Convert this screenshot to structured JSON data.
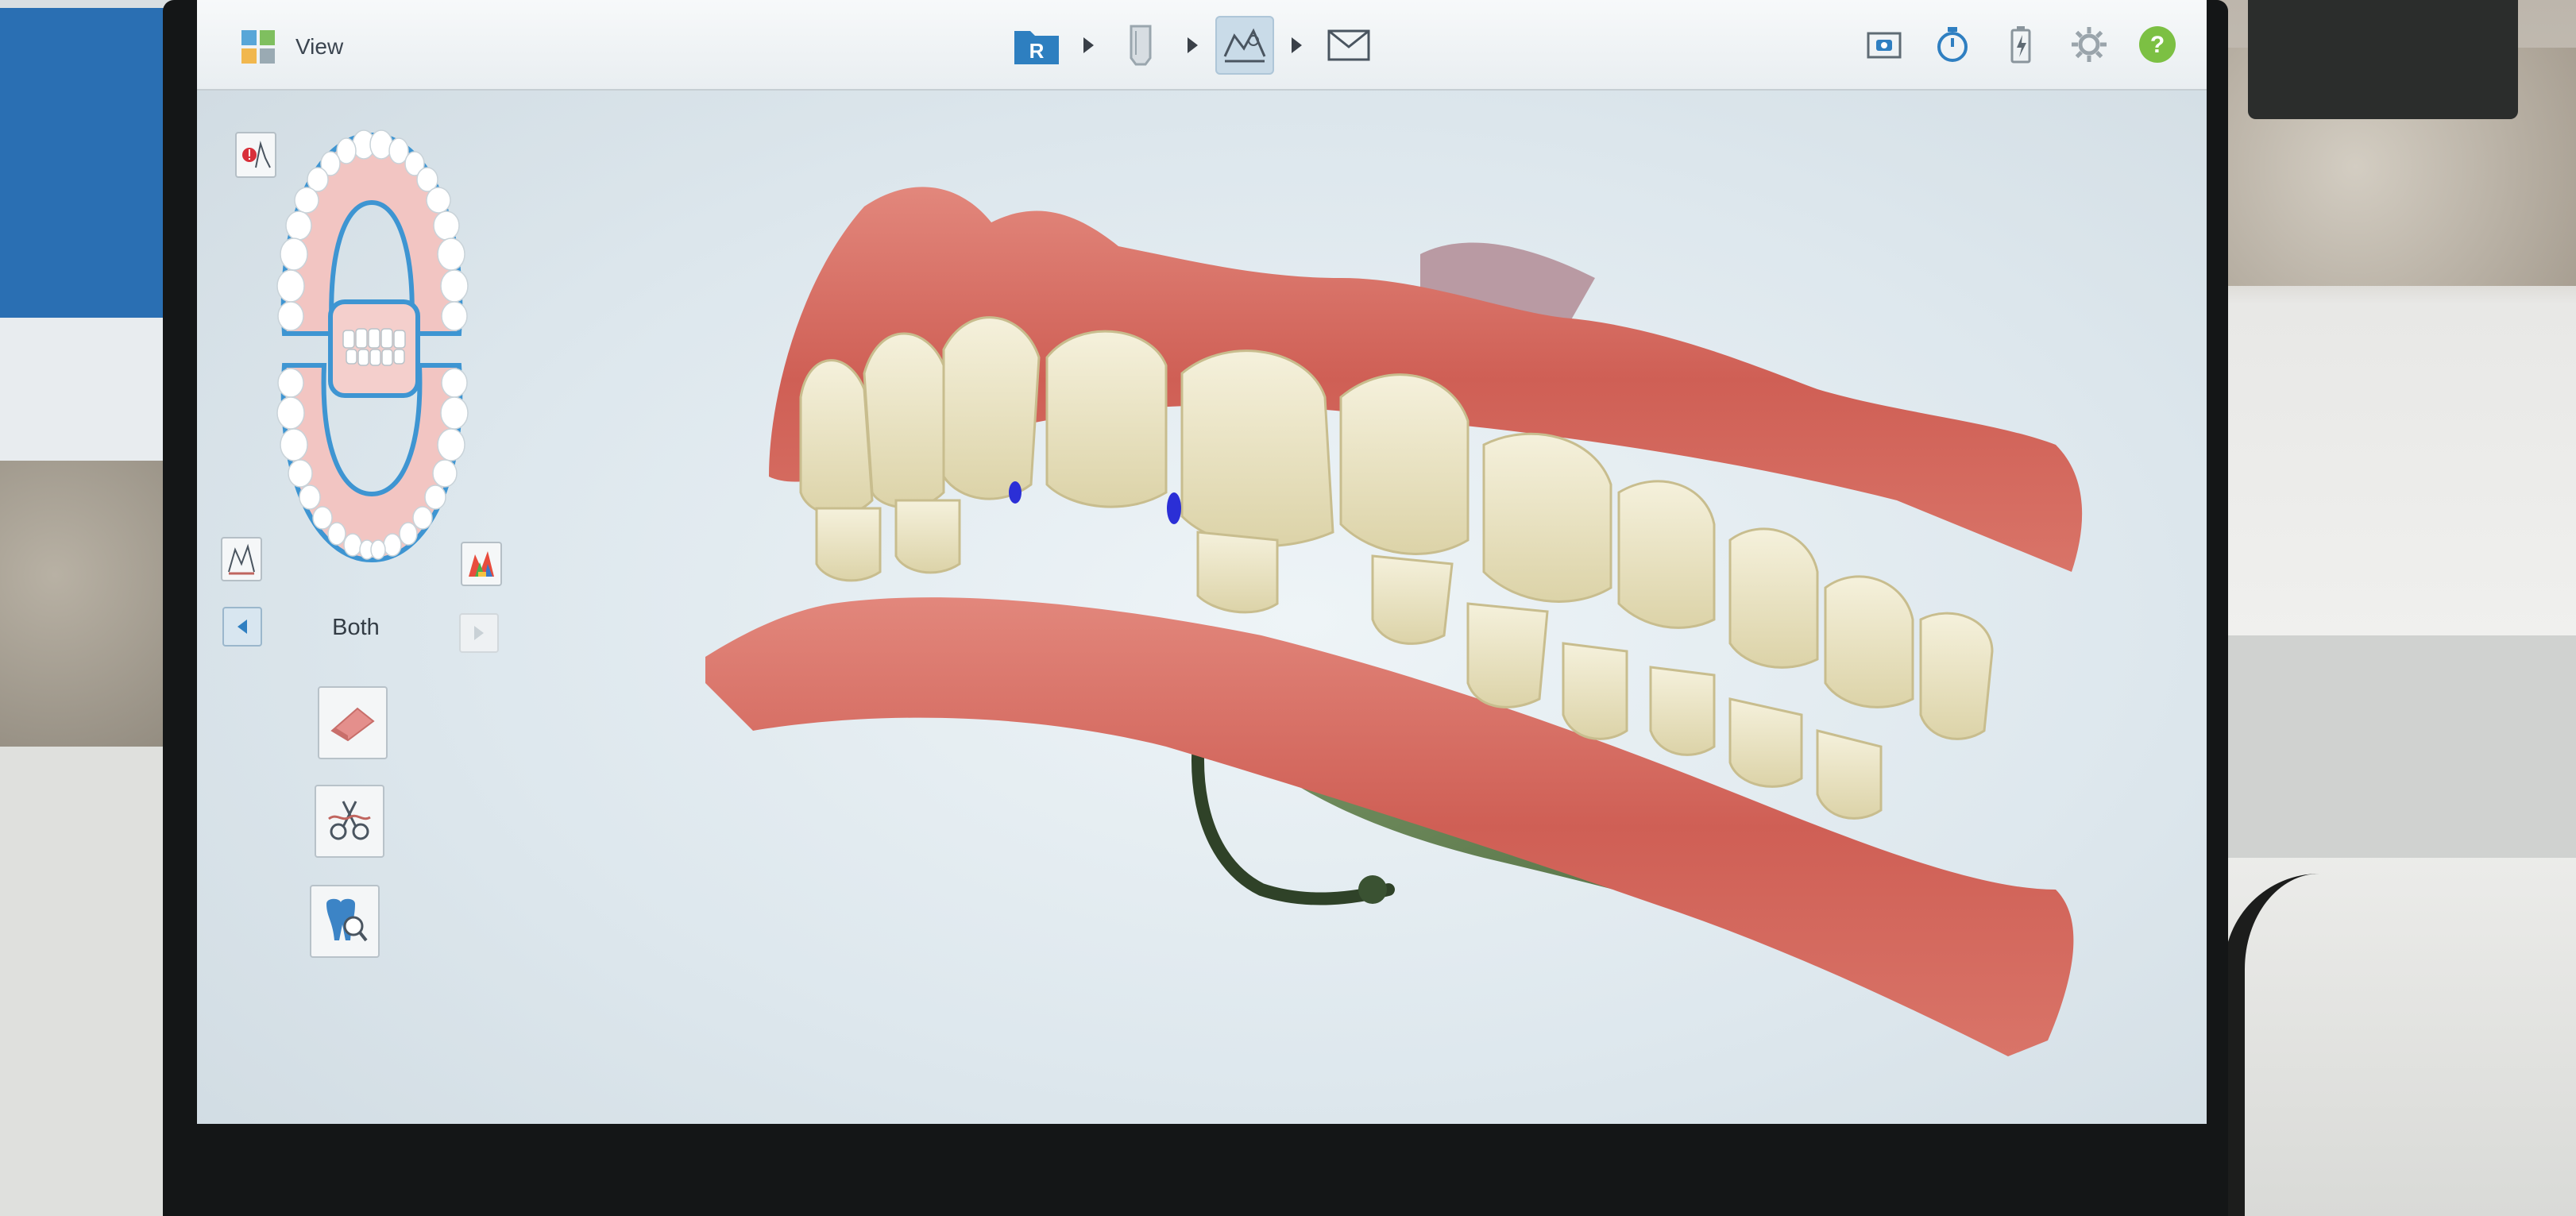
{
  "toolbar": {
    "view_label": "View",
    "view_icon": "grid-icon",
    "workflow_steps": [
      {
        "icon": "rx-folder-icon",
        "letter": "R",
        "active": false
      },
      {
        "icon": "scan-tooth-icon",
        "active": false
      },
      {
        "icon": "view-model-icon",
        "active": true
      },
      {
        "icon": "send-envelope-icon",
        "active": false
      }
    ],
    "right_tools": [
      {
        "icon": "camera-icon"
      },
      {
        "icon": "stopwatch-icon"
      },
      {
        "icon": "battery-icon"
      },
      {
        "icon": "gear-icon"
      },
      {
        "icon": "help-icon",
        "glyph": "?"
      }
    ]
  },
  "left_panel": {
    "arch_selector_label": "Both",
    "tools": [
      {
        "icon": "eraser-icon"
      },
      {
        "icon": "scissors-trim-icon"
      },
      {
        "icon": "tooth-magnifier-icon"
      }
    ]
  },
  "colors": {
    "accent": "#2f7fc1",
    "gum": "#d86a60",
    "tooth": "#ece6c6",
    "tongue": "#6f8a5a",
    "help": "#7cc043",
    "arch_outline": "#3e95d2"
  }
}
